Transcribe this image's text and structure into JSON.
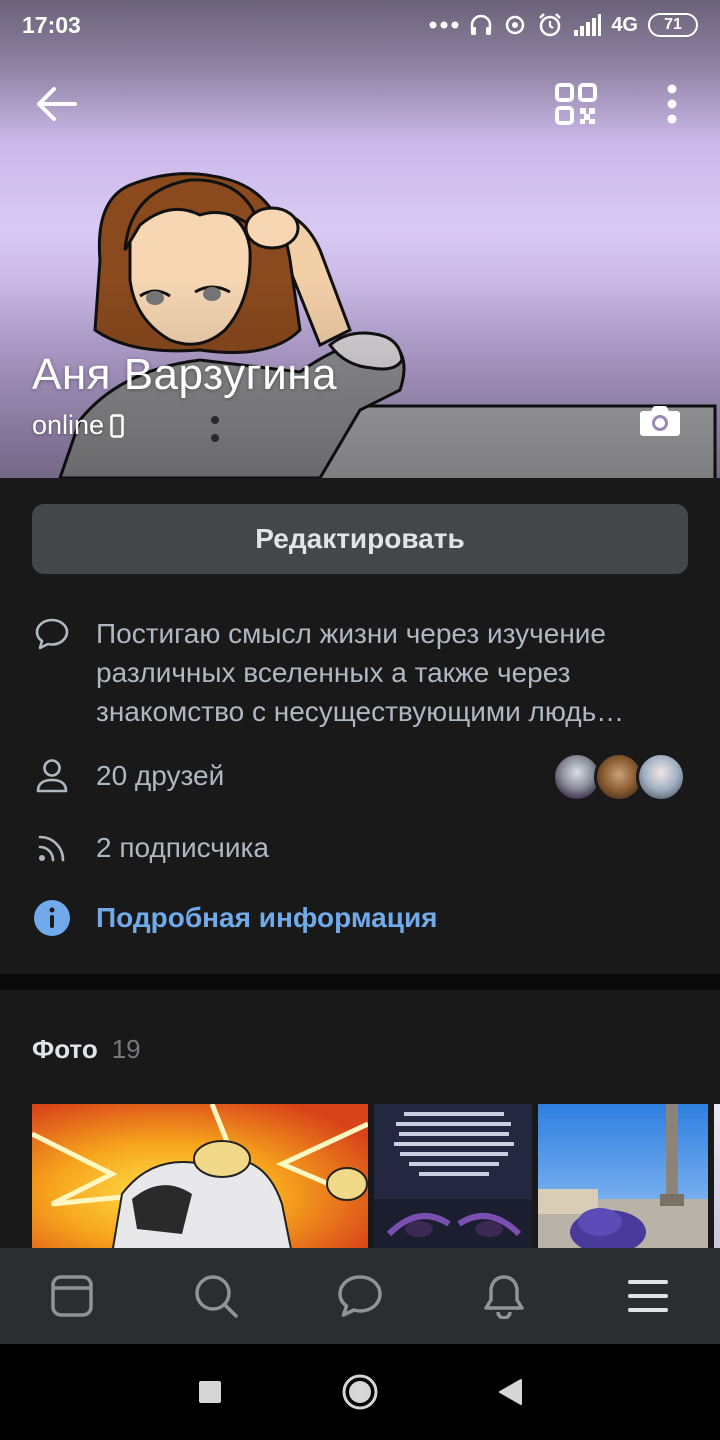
{
  "status_bar": {
    "time": "17:03",
    "network": "4G",
    "battery": "71",
    "icons": [
      "dots-icon",
      "headphones-icon",
      "sync-icon",
      "alarm-icon",
      "signal-icon",
      "battery-icon"
    ]
  },
  "header": {
    "icons": [
      "back-arrow-icon",
      "qr-code-icon",
      "more-vertical-icon",
      "camera-icon"
    ]
  },
  "profile": {
    "name": "Аня Варзугина",
    "online": "online"
  },
  "actions": {
    "edit_label": "Редактировать"
  },
  "info": {
    "status": "Постигаю смысл жизни через изучение различных вселенных а также через знакомство с несуществующими людь…",
    "friends": "20 друзей",
    "followers": "2 подписчика",
    "details": "Подробная информация"
  },
  "photos": {
    "title": "Фото",
    "count": "19"
  },
  "tabbar": {
    "items": [
      "news-icon",
      "search-icon",
      "messages-icon",
      "notifications-icon",
      "menu-icon"
    ]
  },
  "colors": {
    "background": "#19191a",
    "button": "#454647",
    "link": "#71aaeb",
    "secondary_text": "#aeb7c2",
    "tabbar": "#2c2d2e"
  }
}
